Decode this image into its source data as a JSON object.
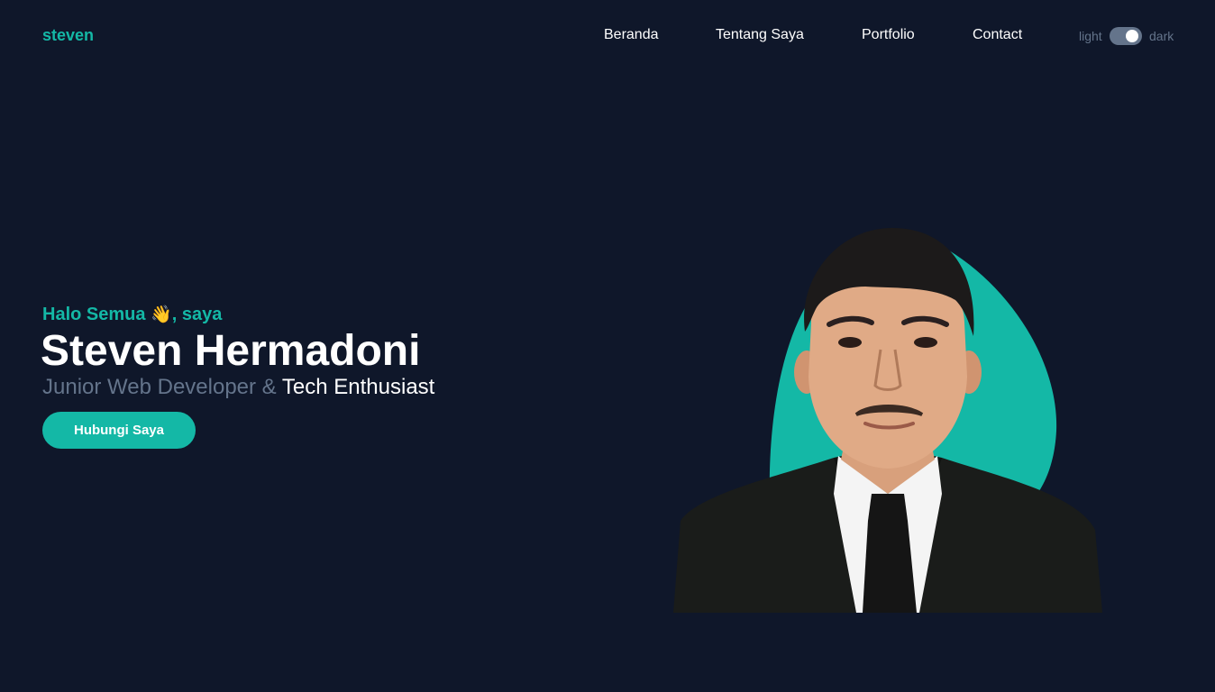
{
  "header": {
    "logo": "steven",
    "nav": [
      "Beranda",
      "Tentang Saya",
      "Portfolio",
      "Contact"
    ],
    "theme": {
      "light_label": "light",
      "dark_label": "dark",
      "is_dark": true
    }
  },
  "hero": {
    "greeting": "Halo Semua",
    "greeting_emoji": "👋",
    "greeting_suffix": ", saya",
    "name": "Steven Hermadoni",
    "role_muted": "Junior Web Developer &",
    "role_highlight": "Tech Enthusiast",
    "cta_label": "Hubungi Saya"
  },
  "colors": {
    "background": "#0f172a",
    "accent": "#14b8a6",
    "muted": "#64748b",
    "text": "#ffffff"
  },
  "icons": {
    "wave": "waving-hand-icon",
    "theme_toggle": "toggle-switch-icon"
  }
}
